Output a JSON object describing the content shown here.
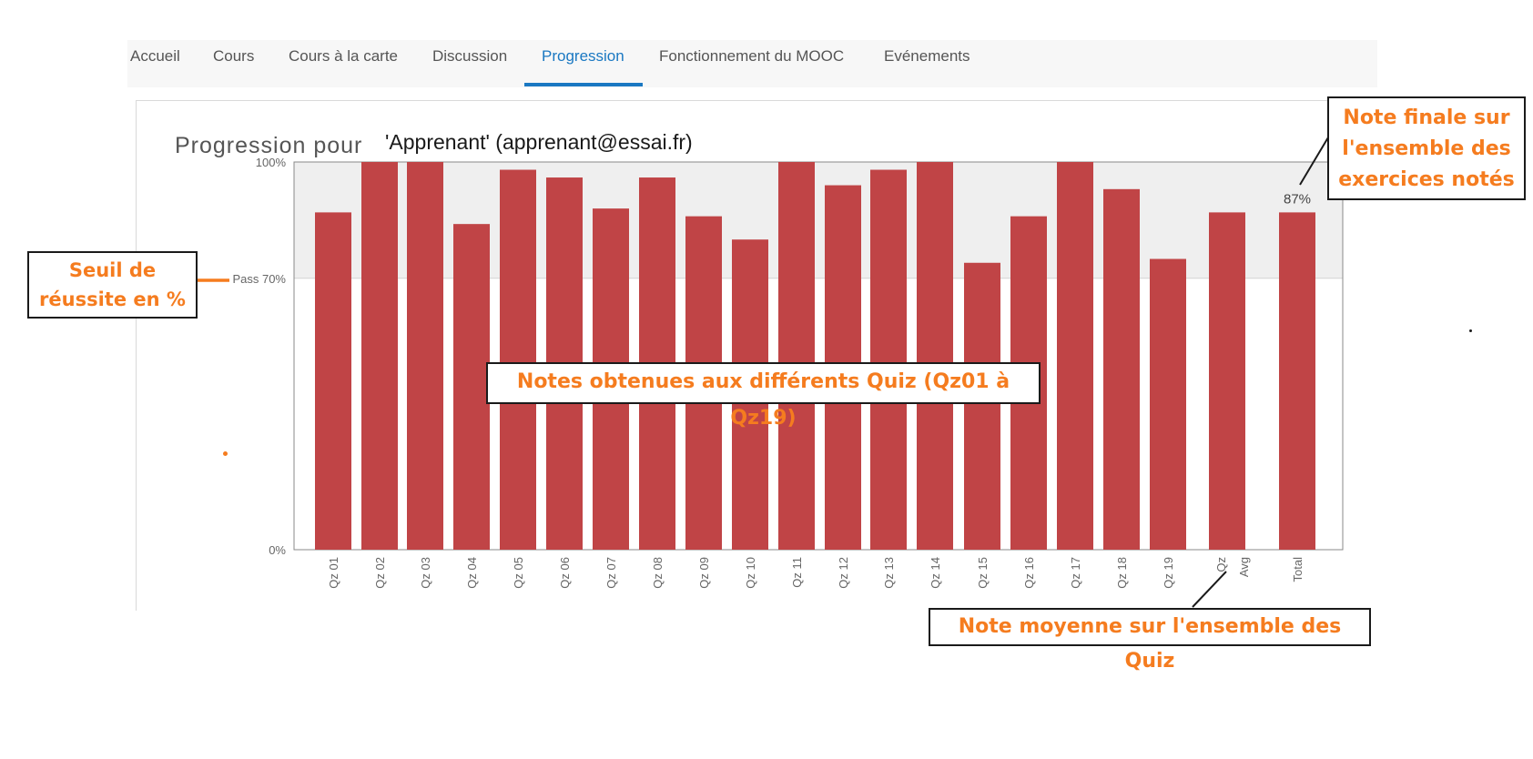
{
  "nav": {
    "items": [
      {
        "label": "Accueil",
        "active": false
      },
      {
        "label": "Cours",
        "active": false
      },
      {
        "label": "Cours à la carte",
        "active": false
      },
      {
        "label": "Discussion",
        "active": false
      },
      {
        "label": "Progression",
        "active": true
      },
      {
        "label": "Fonctionnement du MOOC",
        "active": false
      },
      {
        "label": "Evénements",
        "active": false
      }
    ]
  },
  "page": {
    "title": "Progression pour",
    "student": "'Apprenant' (apprenant@essai.fr)"
  },
  "colors": {
    "bar": "#c04446",
    "accent": "#1a78c2",
    "callout_text": "#f57c1f"
  },
  "chart_data": {
    "type": "bar",
    "categories": [
      "Qz 01",
      "Qz 02",
      "Qz 03",
      "Qz 04",
      "Qz 05",
      "Qz 06",
      "Qz 07",
      "Qz 08",
      "Qz 09",
      "Qz 10",
      "Qz 11",
      "Qz 12",
      "Qz 13",
      "Qz 14",
      "Qz 15",
      "Qz 16",
      "Qz 17",
      "Qz 18",
      "Qz 19",
      "Qz Avg",
      "Total"
    ],
    "values": [
      87,
      100,
      100,
      84,
      98,
      96,
      88,
      96,
      86,
      80,
      100,
      94,
      98,
      100,
      74,
      86,
      100,
      93,
      75,
      87,
      87
    ],
    "ylim": [
      0,
      100
    ],
    "y_ticks": [
      {
        "value": 0,
        "label": "0%"
      },
      {
        "value": 100,
        "label": "100%"
      }
    ],
    "pass_threshold": {
      "value": 70,
      "label": "Pass 70%"
    },
    "total_label": "87%",
    "grid": false
  },
  "callouts": {
    "threshold": [
      "Seuil de",
      "réussite en %"
    ],
    "final": [
      "Note finale sur",
      "l'ensemble des",
      "exercices notés"
    ],
    "quiz": "Notes obtenues aux différents Quiz (Qz01 à Qz19)",
    "average": "Note moyenne sur l'ensemble des Quiz"
  }
}
